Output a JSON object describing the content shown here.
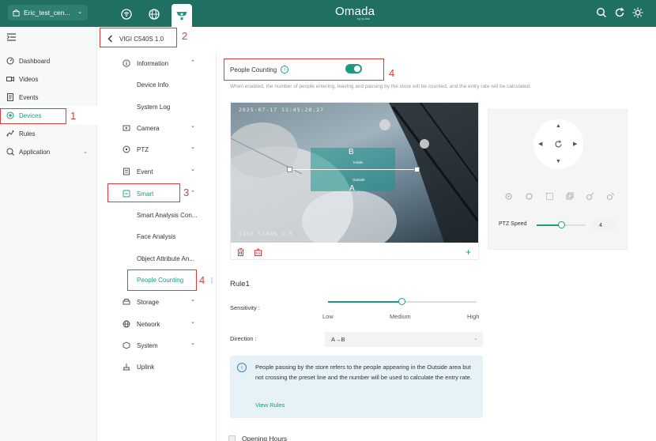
{
  "topbar": {
    "site": "Eric_test_cen...",
    "brand": "Omada",
    "brand_sub": "by tp-link",
    "tabs": [
      "wireless-icon",
      "globe-icon",
      "surveillance-icon"
    ],
    "actions": [
      "search-icon",
      "refresh-icon",
      "theme-icon"
    ],
    "color": "#1f6f63"
  },
  "sidebar": {
    "items": [
      {
        "label": "Dashboard",
        "icon": "dashboard-icon"
      },
      {
        "label": "Videos",
        "icon": "video-icon"
      },
      {
        "label": "Events",
        "icon": "events-icon"
      },
      {
        "label": "Devices",
        "icon": "devices-icon",
        "active": true
      },
      {
        "label": "Rules",
        "icon": "rules-icon"
      },
      {
        "label": "Application",
        "icon": "application-icon"
      }
    ]
  },
  "breadcrumb": {
    "device": "VIGI C540S 1.0"
  },
  "submenu": {
    "information": "Information",
    "device_info": "Device Info",
    "system_log": "System Log",
    "camera": "Camera",
    "ptz": "PTZ",
    "event": "Event",
    "smart": "Smart",
    "smart_analysis": "Smart Analysis Con...",
    "face_analysis": "Face Analysis",
    "object_attr": "Object Attribute An...",
    "people_counting": "People Counting",
    "storage": "Storage",
    "network": "Network",
    "system": "System",
    "uplink": "Uplink"
  },
  "annotations": {
    "n1": "1",
    "n2": "2",
    "n3": "3",
    "n4a": "4",
    "n4b": "4"
  },
  "main": {
    "people_counting_label": "People Counting",
    "toggle_on": true,
    "description": "When enabled, the number of people entering, leaving and passing by the store will be counted, and the entry rate will be calculated.",
    "video": {
      "timestamp": "2025-07-17  11:45:20.27",
      "model": "VIGI C540S 1.0",
      "zone_b": "B",
      "zone_a": "A",
      "inside": "Inside",
      "outside": "Outside"
    },
    "ptz": {
      "speed_label": "PTZ Speed",
      "speed_value": "4",
      "speed_fraction": 0.5
    },
    "rule_title": "Rule1",
    "sensitivity_label": "Sensitivity :",
    "sensitivity": {
      "low": "Low",
      "medium": "Medium",
      "high": "High",
      "value": "Medium"
    },
    "direction_label": "Direction :",
    "direction_value": "A→B",
    "notice": "People passing by the store refers to the people appearing in the Outside area but not crossing the preset line and the number will be used to calculate the entry rate.",
    "view_rules": "View Rules",
    "opening_hours": "Opening Hours"
  }
}
